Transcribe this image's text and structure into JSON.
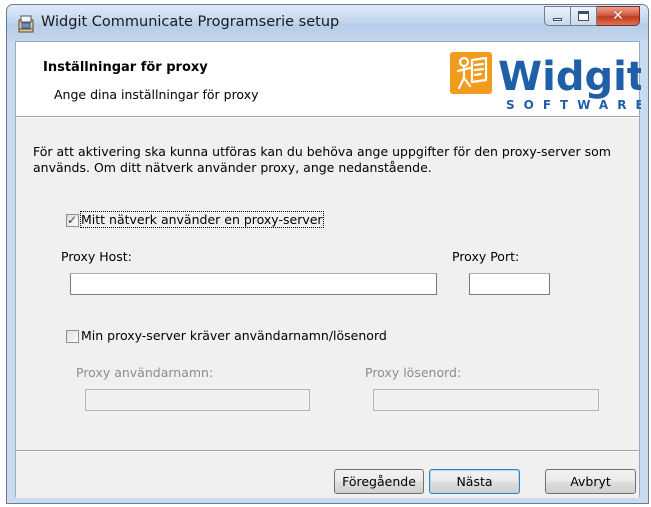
{
  "window": {
    "title": "Widgit Communicate Programserie setup",
    "close_glyph": "✕"
  },
  "header": {
    "title": "Inställningar för proxy",
    "subtitle": "Ange dina inställningar för proxy",
    "logo_text": "Widgit",
    "logo_subtext": "SOFTWARE",
    "logo_color": "#1f5fa8",
    "logo_accent": "#f29b1d"
  },
  "body": {
    "description": "För att aktivering ska kunna utföras kan du behöva ange uppgifter för den proxy-server som används. Om ditt nätverk använder proxy, ange nedanstående.",
    "use_proxy": {
      "label": "Mitt nätverk använder en proxy-server",
      "checked": true,
      "check_glyph": "✓"
    },
    "proxy_host": {
      "label": "Proxy Host:",
      "value": ""
    },
    "proxy_port": {
      "label": "Proxy Port:",
      "value": ""
    },
    "requires_auth": {
      "label": "Min proxy-server kräver användarnamn/lösenord",
      "checked": false
    },
    "username": {
      "label": "Proxy användarnamn:",
      "value": ""
    },
    "password": {
      "label": "Proxy lösenord:",
      "value": ""
    }
  },
  "footer": {
    "back": {
      "label": "Föregående",
      "mnemonic": "F"
    },
    "next": {
      "label": "Nästa",
      "mnemonic": "N"
    },
    "cancel": {
      "label": "Avbryt"
    }
  }
}
